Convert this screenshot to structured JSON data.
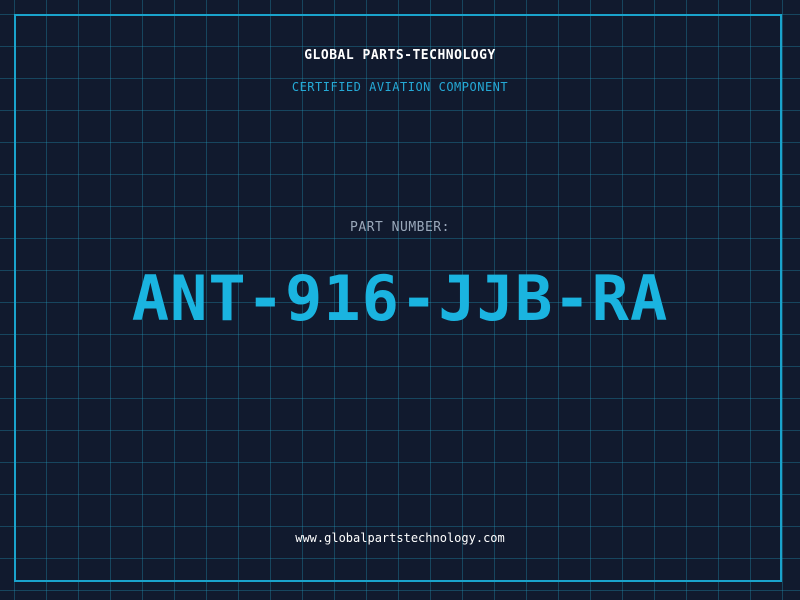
{
  "header": {
    "company": "GLOBAL PARTS-TECHNOLOGY",
    "tagline": "CERTIFIED AVIATION COMPONENT"
  },
  "part": {
    "label": "PART NUMBER:",
    "number": "ANT-916-JJB-RA"
  },
  "footer": {
    "website": "www.globalpartstechnology.com"
  },
  "colors": {
    "background": "#111a2e",
    "grid": "#2296b9",
    "frame": "#1aa3cc",
    "accent": "#1ab4e0",
    "label": "#9aa8ba",
    "text": "#ffffff"
  }
}
